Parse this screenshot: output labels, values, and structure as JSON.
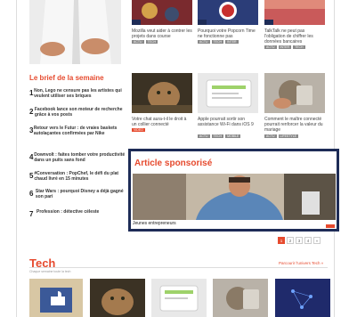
{
  "top_row": {
    "items": [
      {
        "caption": "Mozilla veut aider à contrer les projets dans course",
        "tags": [
          "ACTU",
          "TECH"
        ]
      },
      {
        "caption": "Pourquoi votre Popcorn Time ne fonctionne pas",
        "tags": [
          "ACTU",
          "TECH",
          "INTER"
        ]
      },
      {
        "caption": "TalkTalk ne peut pas l'obligation de chiffrer les données bancaires",
        "tags": [
          "ACTU",
          "INTER",
          "TECH"
        ]
      }
    ]
  },
  "brief": {
    "title": "Le brief de la semaine",
    "items": [
      {
        "num": "1",
        "text": "Non, Lego ne censure pas les artistes qui veulent utiliser ses briques"
      },
      {
        "num": "2",
        "text": "Facebook lance son moteur de recherche grâce à vos posts"
      },
      {
        "num": "3",
        "text": "Retour vers le Futur : de vraies baskets autolaçantes confirmées par Nike"
      },
      {
        "num": "4",
        "text": "Downvolt : faites tomber votre productivité dans un puits sans fond"
      },
      {
        "num": "5",
        "text": "#Conversation : PopChef, le défi du plat chaud livré en 15 minutes"
      },
      {
        "num": "6",
        "text": "Star Wars : pourquoi Disney a déjà gagné son pari"
      },
      {
        "num": "7",
        "text": "Profession : détective céleste"
      }
    ]
  },
  "mid_row": {
    "items": [
      {
        "caption": "Votre chat aura-t-il le droit à un collier connecté",
        "tags": [
          "VIDEO"
        ]
      },
      {
        "caption": "Apple pourrait sortir son assistance Wi-Fi dans iOS 9",
        "tags": [
          "ACTU",
          "TECH",
          "MOBILE"
        ]
      },
      {
        "caption": "Comment le maître connecté pourrait renforcer la valeur du mariage",
        "tags": [
          "ACTU",
          "LIFESTYLE"
        ]
      }
    ]
  },
  "sponsored": {
    "title": "Article sponsorisé",
    "caption": "Jeunes entrepreneurs"
  },
  "pager": {
    "pages": [
      "1",
      "2",
      "3",
      "4",
      "»"
    ],
    "active": "1"
  },
  "tech": {
    "title": "Tech",
    "subtitle": "Chaque semaine toute la tech",
    "more_link": "Parcourir l'univers Tech »"
  },
  "colors": {
    "accent": "#e64a2e",
    "sponsor_border": "#1e2c57"
  }
}
